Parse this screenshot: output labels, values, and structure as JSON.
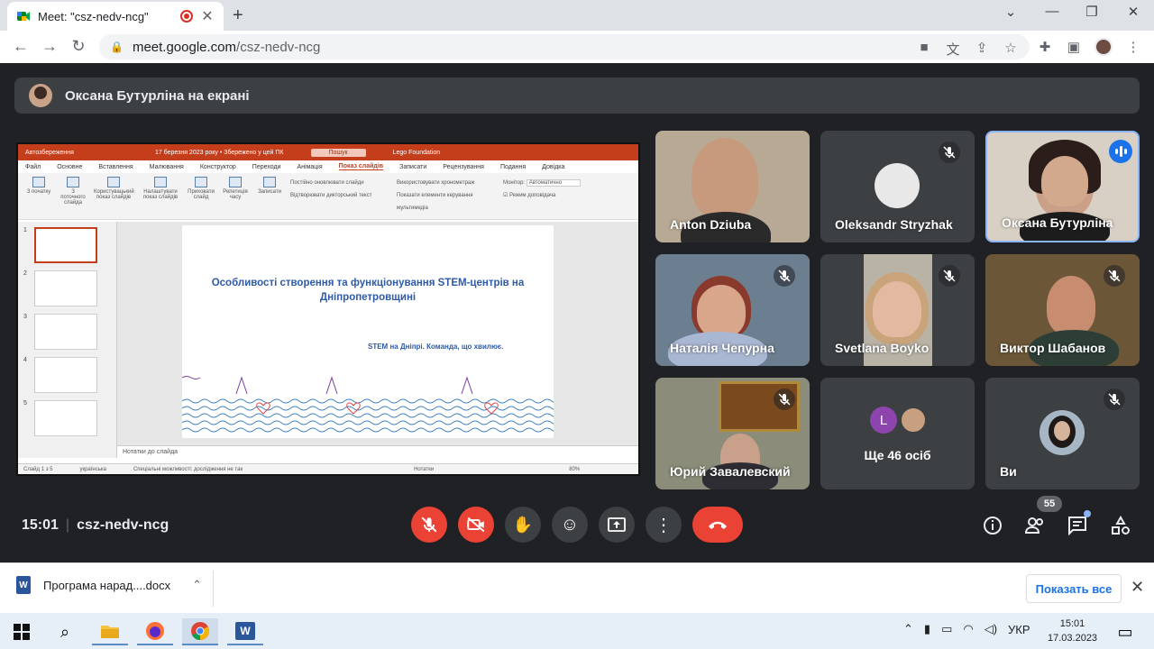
{
  "browser": {
    "tab_title": "Meet: \"csz-nedv-ncg\"",
    "url_host": "meet.google.com",
    "url_path": "/csz-nedv-ncg"
  },
  "meet": {
    "presenter_label": "Оксана Бутурліна на екрані",
    "meeting_time": "15:01",
    "meeting_code": "csz-nedv-ncg",
    "participants_count": "55",
    "participants": [
      {
        "name": "Anton Dziuba",
        "muted": false
      },
      {
        "name": "Oleksandr Stryzhak",
        "muted": true
      },
      {
        "name": "Оксана Бутурліна",
        "muted": false,
        "speaking": true
      },
      {
        "name": "Наталія Чепурна",
        "muted": true
      },
      {
        "name": "Svetlana Boyko",
        "muted": true
      },
      {
        "name": "Виктор Шабанов",
        "muted": true
      },
      {
        "name": "Юрий Завалевский",
        "muted": true
      },
      {
        "name": "Ще 46 осіб",
        "avatar_letter": "L"
      },
      {
        "name": "Ви",
        "muted": true
      }
    ]
  },
  "powerpoint": {
    "autosave": "Автозбереження",
    "file_info": "17 березня 2023 року • Збережено у цей ПК",
    "search": "Пошук",
    "account": "Lego Foundation",
    "menu": [
      "Файл",
      "Основне",
      "Вставлення",
      "Малювання",
      "Конструктор",
      "Переходи",
      "Анімація",
      "Показ слайдів",
      "Записати",
      "Рецензування",
      "Подання",
      "Довідка"
    ],
    "active_menu": "Показ слайдів",
    "ribbon": [
      "З початку",
      "З поточного слайда",
      "Користувацький показ слайдів",
      "Налаштувати показ слайдів",
      "Приховати слайд",
      "Репетиція часу",
      "Записати"
    ],
    "ribbon_options": [
      "Постійно оновлювати слайди",
      "Відтворювати дикторський текст",
      "Використовувати хронометраж",
      "Показати елементи керування мультимедіа"
    ],
    "monitor_label": "Монітор:",
    "monitor_value": "Автоматично",
    "presenter_view": "Режим доповідача",
    "group_labels": [
      "Початок показу слайдів",
      "Налаштування",
      "Монітори"
    ],
    "slide_title": "Особливості створення та функціонування STEM-центрів на Дніпропетровщині",
    "slide_subtitle": "STEM на Дніпрі. Команда, що хвилює.",
    "notes_placeholder": "Нотатки до слайда",
    "status_slide": "Слайд 1 з 5",
    "status_lang": "українська",
    "status_access": "Спеціальні можливості: дослідження не так",
    "status_notes": "Нотатки",
    "zoom": "80%",
    "thumbnail_numbers": [
      "1",
      "2",
      "3",
      "4",
      "5"
    ]
  },
  "downloads": {
    "file": "Програма нарад....docx",
    "show_all": "Показать все"
  },
  "taskbar": {
    "lang": "УКР",
    "time": "15:01",
    "date": "17.03.2023"
  },
  "colors": {
    "meet_bg": "#202124",
    "tile_bg": "#3c4043",
    "red": "#ea4335",
    "accent_blue": "#8ab4f8",
    "ppt_red": "#c43e1c",
    "slide_text": "#2e5aa8"
  }
}
